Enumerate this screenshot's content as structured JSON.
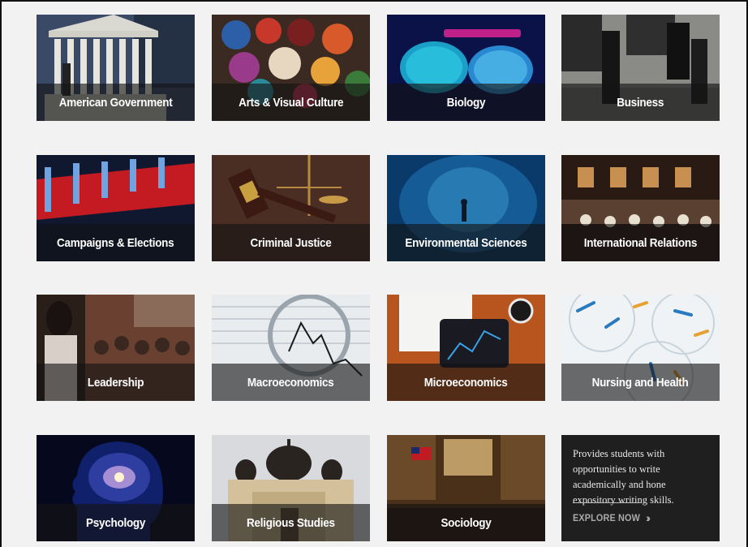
{
  "tiles": [
    {
      "label": "American Government"
    },
    {
      "label": "Arts & Visual Culture"
    },
    {
      "label": "Biology"
    },
    {
      "label": "Business"
    },
    {
      "label": "Campaigns & Elections"
    },
    {
      "label": "Criminal Justice"
    },
    {
      "label": "Environmental Sciences"
    },
    {
      "label": "International Relations"
    },
    {
      "label": "Leadership"
    },
    {
      "label": "Macroeconomics"
    },
    {
      "label": "Microeconomics"
    },
    {
      "label": "Nursing and Health"
    },
    {
      "label": "Psychology"
    },
    {
      "label": "Religious Studies"
    },
    {
      "label": "Sociology"
    }
  ],
  "promo": {
    "text": "Provides students with opportunities to write academically and hone expository writing skills.",
    "link_label": "EXPLORE NOW",
    "link_icon": "double-chevron-right-icon"
  }
}
